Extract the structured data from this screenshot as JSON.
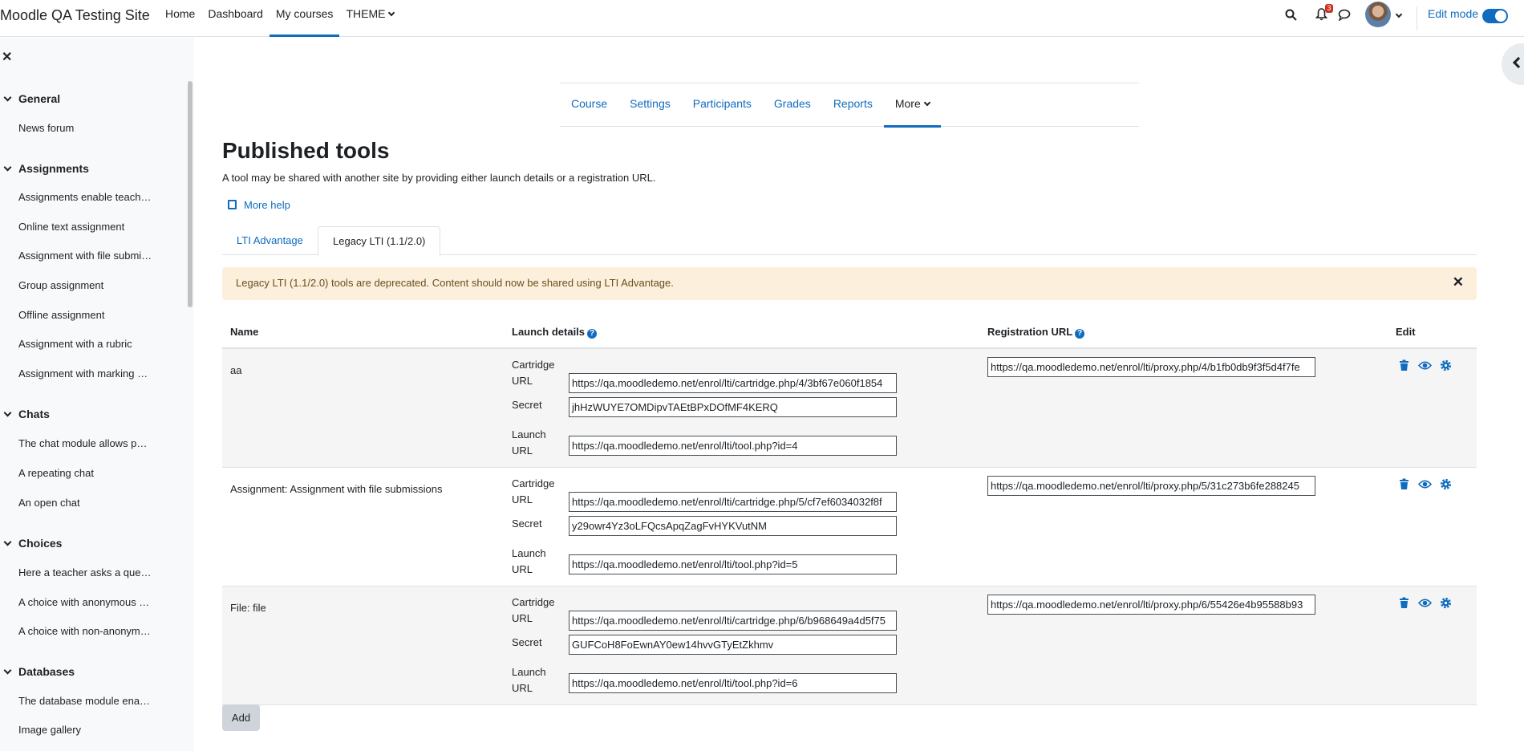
{
  "navbar": {
    "site_name": "Moodle QA Testing Site",
    "items": [
      {
        "label": "Home",
        "active": false
      },
      {
        "label": "Dashboard",
        "active": false
      },
      {
        "label": "My courses",
        "active": true
      },
      {
        "label": "THEME",
        "active": false,
        "dropdown": true
      }
    ],
    "notification_count": "3",
    "edit_mode_label": "Edit mode",
    "edit_mode_on": true,
    "icons": [
      "search-icon",
      "bell-icon",
      "chat-icon",
      "avatar",
      "chevron-down-icon"
    ],
    "accent_color": "#0f6cbf"
  },
  "course_index": {
    "sections": [
      {
        "title": "General",
        "items": [
          "News forum"
        ]
      },
      {
        "title": "Assignments",
        "items": [
          "Assignments enable teach…",
          "Online text assignment",
          "Assignment with file submi…",
          "Group assignment",
          "Offline assignment",
          "Assignment with a rubric",
          "Assignment with marking …"
        ]
      },
      {
        "title": "Chats",
        "items": [
          "The chat module allows p…",
          "A repeating chat",
          "An open chat"
        ]
      },
      {
        "title": "Choices",
        "items": [
          "Here a teacher asks a que…",
          "A choice with anonymous …",
          "A choice with non-anonym…"
        ]
      },
      {
        "title": "Databases",
        "items": [
          "The database module ena…",
          "Image gallery"
        ]
      }
    ]
  },
  "secondary_nav": {
    "items": [
      {
        "label": "Course",
        "active": false
      },
      {
        "label": "Settings",
        "active": false
      },
      {
        "label": "Participants",
        "active": false
      },
      {
        "label": "Grades",
        "active": false
      },
      {
        "label": "Reports",
        "active": false
      },
      {
        "label": "More",
        "active": true,
        "dropdown": true
      }
    ]
  },
  "page": {
    "title": "Published tools",
    "description": "A tool may be shared with another site by providing either launch details or a registration URL.",
    "more_help": "More help",
    "tabs": [
      {
        "label": "LTI Advantage",
        "active": false
      },
      {
        "label": "Legacy LTI (1.1/2.0)",
        "active": true
      }
    ],
    "alert": "Legacy LTI (1.1/2.0) tools are deprecated. Content should now be shared using LTI Advantage.",
    "alert_color": "#fcefdc"
  },
  "table": {
    "headers": {
      "name": "Name",
      "launch": "Launch details",
      "registration": "Registration URL",
      "edit": "Edit"
    },
    "labels": {
      "cartridge_1": "Cartridge",
      "cartridge_2": "URL",
      "secret": "Secret",
      "launch_1": "Launch",
      "launch_2": "URL"
    },
    "rows": [
      {
        "name": "aa",
        "cartridge_url": "https://qa.moodledemo.net/enrol/lti/cartridge.php/4/3bf67e060f1854",
        "secret": "jhHzWUYE7OMDipvTAEtBPxDOfMF4KERQ",
        "launch_url": "https://qa.moodledemo.net/enrol/lti/tool.php?id=4",
        "registration_url": "https://qa.moodledemo.net/enrol/lti/proxy.php/4/b1fb0db9f3f5d4f7fe"
      },
      {
        "name": "Assignment: Assignment with file submissions",
        "cartridge_url": "https://qa.moodledemo.net/enrol/lti/cartridge.php/5/cf7ef6034032f8f",
        "secret": "y29owr4Yz3oLFQcsApqZagFvHYKVutNM",
        "launch_url": "https://qa.moodledemo.net/enrol/lti/tool.php?id=5",
        "registration_url": "https://qa.moodledemo.net/enrol/lti/proxy.php/5/31c273b6fe288245"
      },
      {
        "name": "File: file",
        "cartridge_url": "https://qa.moodledemo.net/enrol/lti/cartridge.php/6/b968649a4d5f75",
        "secret": "GUFCoH8FoEwnAY0ew14hvvGTyEtZkhmv",
        "launch_url": "https://qa.moodledemo.net/enrol/lti/tool.php?id=6",
        "registration_url": "https://qa.moodledemo.net/enrol/lti/proxy.php/6/55426e4b95588b93"
      }
    ],
    "edit_icons": [
      "trash-icon",
      "eye-icon",
      "gear-icon"
    ]
  },
  "add_button": "Add"
}
